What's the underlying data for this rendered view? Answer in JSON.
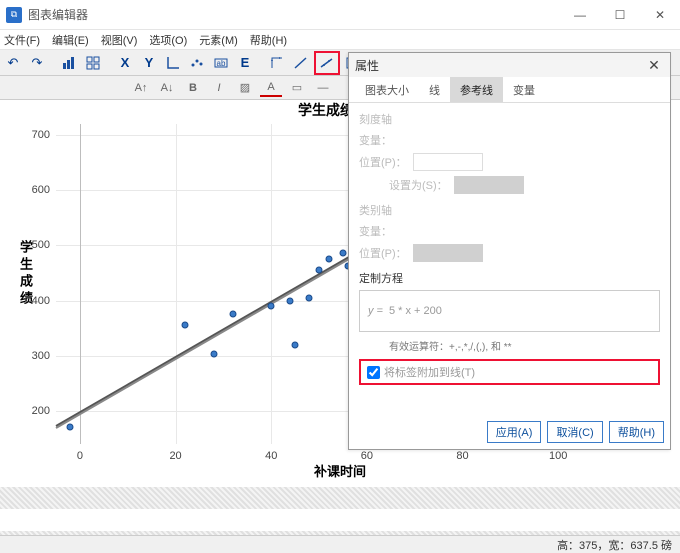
{
  "window": {
    "title": "图表编辑器"
  },
  "menu": {
    "file": "文件(F)",
    "edit": "编辑(E)",
    "view": "视图(V)",
    "options": "选项(O)",
    "elements": "元素(M)",
    "help": "帮助(H)"
  },
  "toolbar": {
    "x_icon": "X",
    "y_icon": "Y",
    "E_icon": "E"
  },
  "chart_data": {
    "type": "scatter",
    "title": "学生成绩和补",
    "xlabel": "补课时间",
    "ylabel": "学生成绩",
    "xlim": [
      -5,
      110
    ],
    "ylim": [
      140,
      720
    ],
    "xticks": [
      0,
      20,
      40,
      60,
      80,
      100
    ],
    "yticks": [
      200,
      300,
      400,
      500,
      600,
      700
    ],
    "points": [
      {
        "x": -2,
        "y": 170
      },
      {
        "x": 22,
        "y": 355
      },
      {
        "x": 28,
        "y": 303
      },
      {
        "x": 32,
        "y": 375
      },
      {
        "x": 40,
        "y": 390
      },
      {
        "x": 44,
        "y": 400
      },
      {
        "x": 45,
        "y": 320
      },
      {
        "x": 48,
        "y": 405
      },
      {
        "x": 50,
        "y": 455
      },
      {
        "x": 52,
        "y": 475
      },
      {
        "x": 55,
        "y": 487
      },
      {
        "x": 56,
        "y": 463
      }
    ],
    "fit_line": {
      "slope": 5,
      "intercept": 200
    }
  },
  "props": {
    "title": "属性",
    "tabs": {
      "size": "图表大小",
      "line": "线",
      "ref": "参考线",
      "var": "变量"
    },
    "scale_axis": "刻度轴",
    "variable": "变量：",
    "position": "位置(P)：",
    "set_to": "设置为(S)：",
    "cat_axis": "类别轴",
    "custom_eq": "定制方程",
    "equation": "5 * x + 200",
    "eq_prefix": "y =",
    "valid_ops": "有效运算符：+,-,*,/,(,), 和 **",
    "attach": "将标签附加到线(T)",
    "apply": "应用(A)",
    "cancel": "取消(C)",
    "help": "帮助(H)"
  },
  "status": {
    "text": "高：375，宽：637.5 磅"
  }
}
